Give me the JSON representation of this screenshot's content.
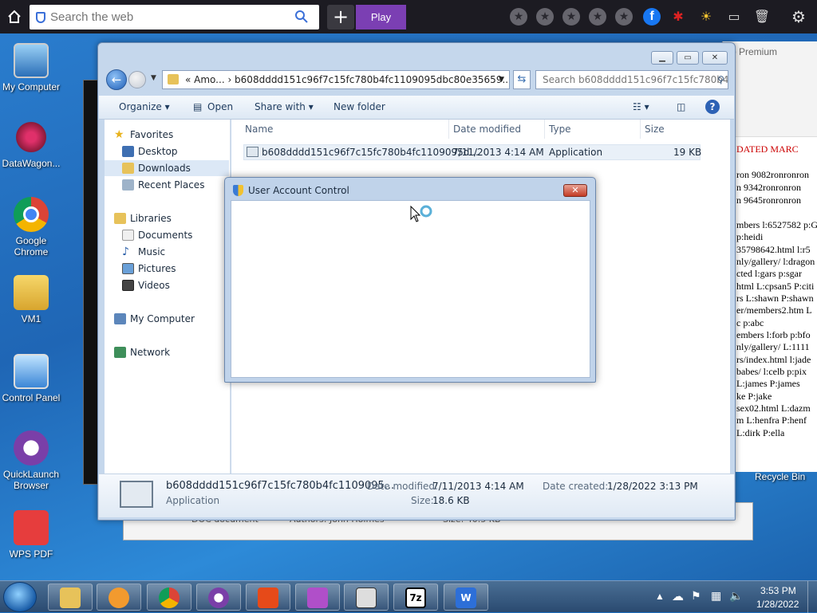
{
  "browser_bar": {
    "search_placeholder": "Search the web",
    "play_label": "Play"
  },
  "desktop_icons": [
    {
      "label": "My Computer"
    },
    {
      "label": "DataWagon..."
    },
    {
      "label": "Google Chrome"
    },
    {
      "label": "VM1"
    },
    {
      "label": "Control Panel"
    },
    {
      "label": "QuickLaunch Browser"
    },
    {
      "label": "WPS PDF"
    }
  ],
  "background_doc": {
    "top_label": "o Premium",
    "heading": "DATED MARC",
    "lines": [
      "ron 9082ronronron",
      "n 9342ronronron",
      "n 9645ronronron",
      "",
      "mbers l:6527582 p:G",
      " p:heidi",
      "35798642.html l:r5",
      "nly/gallery/ l:dragon",
      "cted l:gars p:sgar",
      "html L:cpsan5 P:citi",
      "rs L:shawn P:shawn",
      "er/members2.htm L",
      "c p:abc",
      "embers l:forb p:bfo",
      "nly/gallery/ L:1111",
      "rs/index.html l:jade",
      "babes/ l:celb p:pix",
      "L:james P:james",
      "ke P:jake",
      "sex02.html L:dazm",
      "m L:henfra P:henf",
      "L:dirk P:ella"
    ],
    "recycle_label": "Recycle Bin"
  },
  "explorer": {
    "address": "« Amo... › b608dddd151c96f7c15fc780b4fc1109095dbc80e35659...",
    "search_placeholder": "Search b608dddd151c96f7c15fc780b4f...",
    "toolbar": {
      "organize": "Organize ▾",
      "open": "Open",
      "share_with": "Share with ▾",
      "new_folder": "New folder"
    },
    "nav": {
      "favorites": "Favorites",
      "desktop": "Desktop",
      "downloads": "Downloads",
      "recent": "Recent Places",
      "libraries": "Libraries",
      "documents": "Documents",
      "music": "Music",
      "pictures": "Pictures",
      "videos": "Videos",
      "my_computer": "My Computer",
      "network": "Network"
    },
    "columns": {
      "name": "Name",
      "date_modified": "Date modified",
      "type": "Type",
      "size": "Size"
    },
    "file": {
      "name": "b608dddd151c96f7c15fc780b4fc1109095d...",
      "date": "7/11/2013 4:14 AM",
      "type": "Application",
      "size": "19 KB"
    },
    "details": {
      "name": "b608dddd151c96f7c15fc780b4fc1109095...",
      "kind": "Application",
      "date_modified_label": "Date modified:",
      "date_modified": "7/11/2013 4:14 AM",
      "size_label": "Size:",
      "size": "18.6 KB",
      "date_created_label": "Date created:",
      "date_created": "1/28/2022 3:13 PM"
    }
  },
  "behind_window": {
    "c1": "DOC document",
    "c2": "Authors: John Holmes",
    "c3": "Size: 40.5 KB"
  },
  "uac": {
    "title": "User Account Control",
    "close": "✕"
  },
  "taskbar": {
    "time": "3:53 PM",
    "date": "1/28/2022"
  },
  "colors": {
    "accent": "#7b3fb3",
    "topbar": "#1c1b22",
    "window_frame": "#c5d7ec"
  }
}
